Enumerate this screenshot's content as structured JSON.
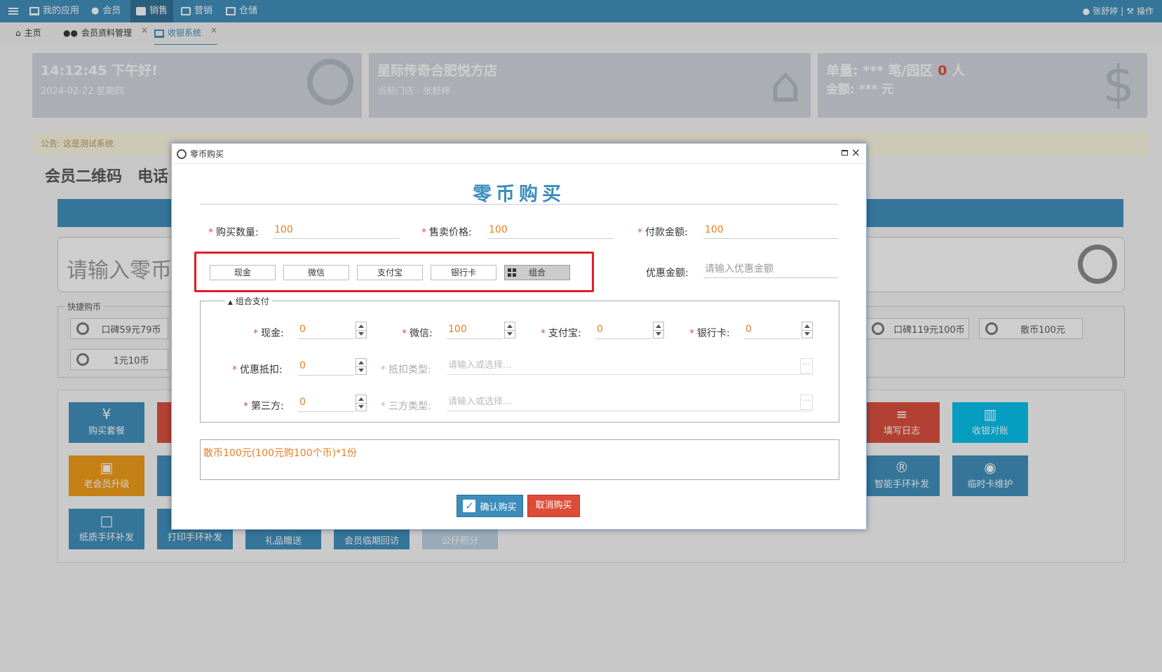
{
  "topbar": {
    "menu_icon": "hamburger-icon",
    "items": [
      {
        "label": "我的应用",
        "icon": "monitor-icon"
      },
      {
        "label": "会员",
        "icon": "user-icon"
      },
      {
        "label": "销售",
        "icon": "briefcase-icon"
      },
      {
        "label": "营销",
        "icon": "chat-icon"
      },
      {
        "label": "仓储",
        "icon": "image-icon"
      }
    ],
    "user": "张舒婷",
    "separator": "|",
    "operation": "操作"
  },
  "tabs": [
    {
      "label": "主页",
      "icon": "home-icon"
    },
    {
      "label": "会员资料管理",
      "icon": "users-icon",
      "close": "×"
    },
    {
      "label": "收银系统",
      "icon": "monitor-icon",
      "close": "×"
    }
  ],
  "cards": {
    "time": {
      "title": "14:12:45 下午好!",
      "sub": "2024-02-22 星期四"
    },
    "store": {
      "title": "星际传奇合肥悦方店",
      "sub": "当前门店 - 张舒婷"
    },
    "stats": {
      "line1_a": "单量:",
      "line1_b": "*** 笔/园区",
      "line1_c": "0",
      "line1_d": "人",
      "line2_a": "金额:",
      "line2_b": "*** 元"
    }
  },
  "notice": "公告: 这是测试系统",
  "section_titles": [
    "会员二维码",
    "电话"
  ],
  "coin_input_placeholder": "请输入零币",
  "quick_buy": {
    "legend": "快捷购币",
    "items": [
      "口碑59元79币",
      "1元10币",
      "口碑119元100币",
      "散币100元"
    ]
  },
  "function_buttons": [
    {
      "label": "购买套餐",
      "icon": "¥"
    },
    {
      "label": "老会员升级",
      "icon": "card-icon"
    },
    {
      "label": "纸质手环补发",
      "icon": "file-icon"
    },
    {
      "label": "打印手环补发"
    },
    {
      "label": "礼品赠送"
    },
    {
      "label": "会员临期回访"
    },
    {
      "label": "公仔积分"
    },
    {
      "label": "填写日志",
      "icon": "stack-icon"
    },
    {
      "label": "收银对账",
      "icon": "bar-chart-icon"
    },
    {
      "label": "智能手环补发",
      "icon": "registered-icon"
    },
    {
      "label": "临时卡维护",
      "icon": "gamepad-icon"
    }
  ],
  "dialog": {
    "window_title": "零币购买",
    "heading": "零币购买",
    "qty_label": "购买数量:",
    "qty_value": "100",
    "price_label": "售卖价格:",
    "price_value": "100",
    "pay_label": "付款金额:",
    "pay_value": "100",
    "pay_methods": [
      "现金",
      "微信",
      "支付宝",
      "银行卡",
      "组合"
    ],
    "selected_method": "组合",
    "discount_label": "优惠金额:",
    "discount_placeholder": "请输入优惠金额",
    "combo_legend": "组合支付",
    "combo": {
      "cash_label": "现金:",
      "cash_value": "0",
      "wechat_label": "微信:",
      "wechat_value": "100",
      "alipay_label": "支付宝:",
      "alipay_value": "0",
      "bankcard_label": "银行卡:",
      "bankcard_value": "0",
      "coupon_label": "优惠抵扣:",
      "coupon_value": "0",
      "deduct_type_label": "抵扣类型:",
      "deduct_type_placeholder": "请输入或选择...",
      "third_label": "第三方:",
      "third_value": "0",
      "third_type_label": "三方类型:",
      "third_type_placeholder": "请输入或选择..."
    },
    "summary": "散币100元(100元购100个币)*1份",
    "confirm": "确认购买",
    "cancel": "取消购买",
    "required_mark": "*"
  },
  "colors": {
    "primary": "#3c8dbc",
    "danger": "#dd4b39",
    "accent_text": "#e67e22"
  }
}
